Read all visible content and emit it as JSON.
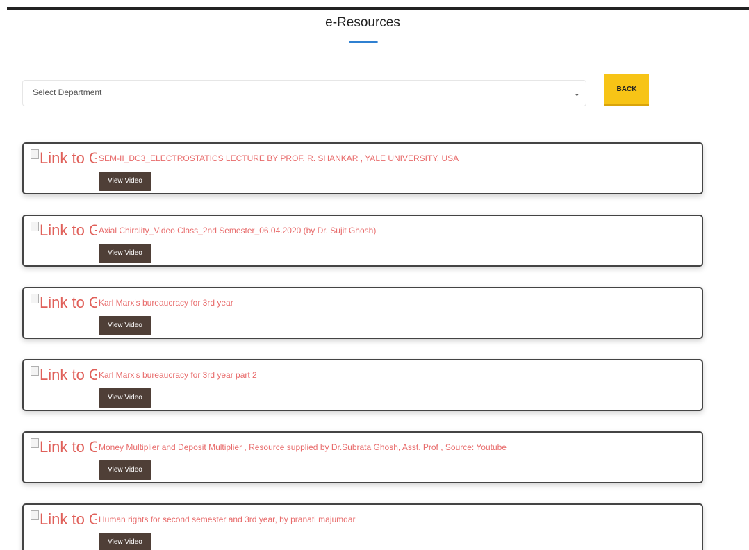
{
  "header": {
    "title": "e-Resources",
    "accent_color": "#2f80d1"
  },
  "filter": {
    "select_value": "Select Department",
    "chevron_icon": "chevron-down-icon",
    "back_label": "BACK",
    "back_color": "#f7c416"
  },
  "resources": [
    {
      "thumb_alt": "Link to Google.com",
      "title": "SEM-II_DC3_ELECTROSTATICS LECTURE BY PROF. R. SHANKAR , YALE UNIVERSITY, USA",
      "button_label": "View Video"
    },
    {
      "thumb_alt": "Link to Google.com",
      "title": "Axial Chirality_Video Class_2nd Semester_06.04.2020 (by Dr. Sujit Ghosh)",
      "button_label": "View Video"
    },
    {
      "thumb_alt": "Link to Google.com",
      "title": "Karl Marx's bureaucracy for 3rd year",
      "button_label": "View Video"
    },
    {
      "thumb_alt": "Link to Google.com",
      "title": "Karl Marx's bureaucracy for 3rd year part 2",
      "button_label": "View Video"
    },
    {
      "thumb_alt": "Link to Google.com",
      "title": "Money Multiplier and Deposit Multiplier , Resource supplied by Dr.Subrata Ghosh, Asst. Prof , Source: Youtube",
      "button_label": "View Video"
    },
    {
      "thumb_alt": "Link to Google.com",
      "title": "Human rights for second semester and 3rd year, by pranati majumdar",
      "button_label": "View Video"
    }
  ],
  "colors": {
    "link_text": "#e86b6b",
    "button_bg": "#4f3f37"
  }
}
